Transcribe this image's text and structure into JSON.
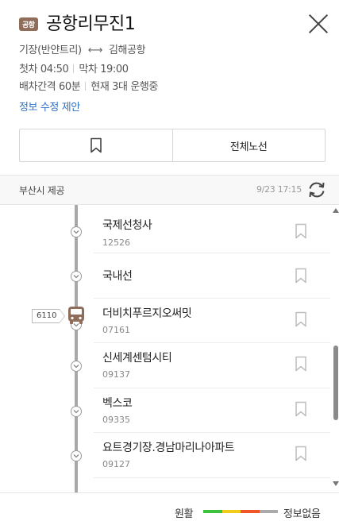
{
  "header": {
    "badge": "공항",
    "title": "공항리무진1",
    "from": "기장(반얀트리)",
    "to": "김해공항",
    "first_label": "첫차",
    "first_time": "04:50",
    "last_label": "막차",
    "last_time": "19:00",
    "interval_label": "배차간격",
    "interval_value": "60분",
    "operating": "현재 3대 운행중",
    "suggest_link": "정보 수정 제안"
  },
  "actions": {
    "full_route_label": "전체노선"
  },
  "provider": {
    "name": "부산시 제공",
    "updated": "9/23 17:15"
  },
  "stops": [
    {
      "name": "국제선청사",
      "code": "12526"
    },
    {
      "name": "국내선",
      "code": ""
    },
    {
      "name": "더비치푸르지오써밋",
      "code": "07161"
    },
    {
      "name": "신세계센텀시티",
      "code": "09137"
    },
    {
      "name": "벡스코",
      "code": "09335"
    },
    {
      "name": "요트경기장.경남마리나아파트",
      "code": "09127"
    }
  ],
  "bus": {
    "number": "6110",
    "at_stop_index": 2,
    "color": "#8f6d5a"
  },
  "legend": {
    "good_label": "원활",
    "none_label": "정보없음",
    "colors": [
      "#3cc23c",
      "#f2cc1a",
      "#f0562a",
      "#aaaaaa"
    ]
  },
  "colors": {
    "accent_link": "#2c71c9",
    "badge": "#8f6d5a"
  },
  "icons": {
    "close": "close-icon",
    "bookmark": "bookmark-icon",
    "refresh": "refresh-icon",
    "bus": "bus-icon",
    "stop_node": "chevron-down-icon",
    "direction": "bidirectional-arrow-icon"
  }
}
